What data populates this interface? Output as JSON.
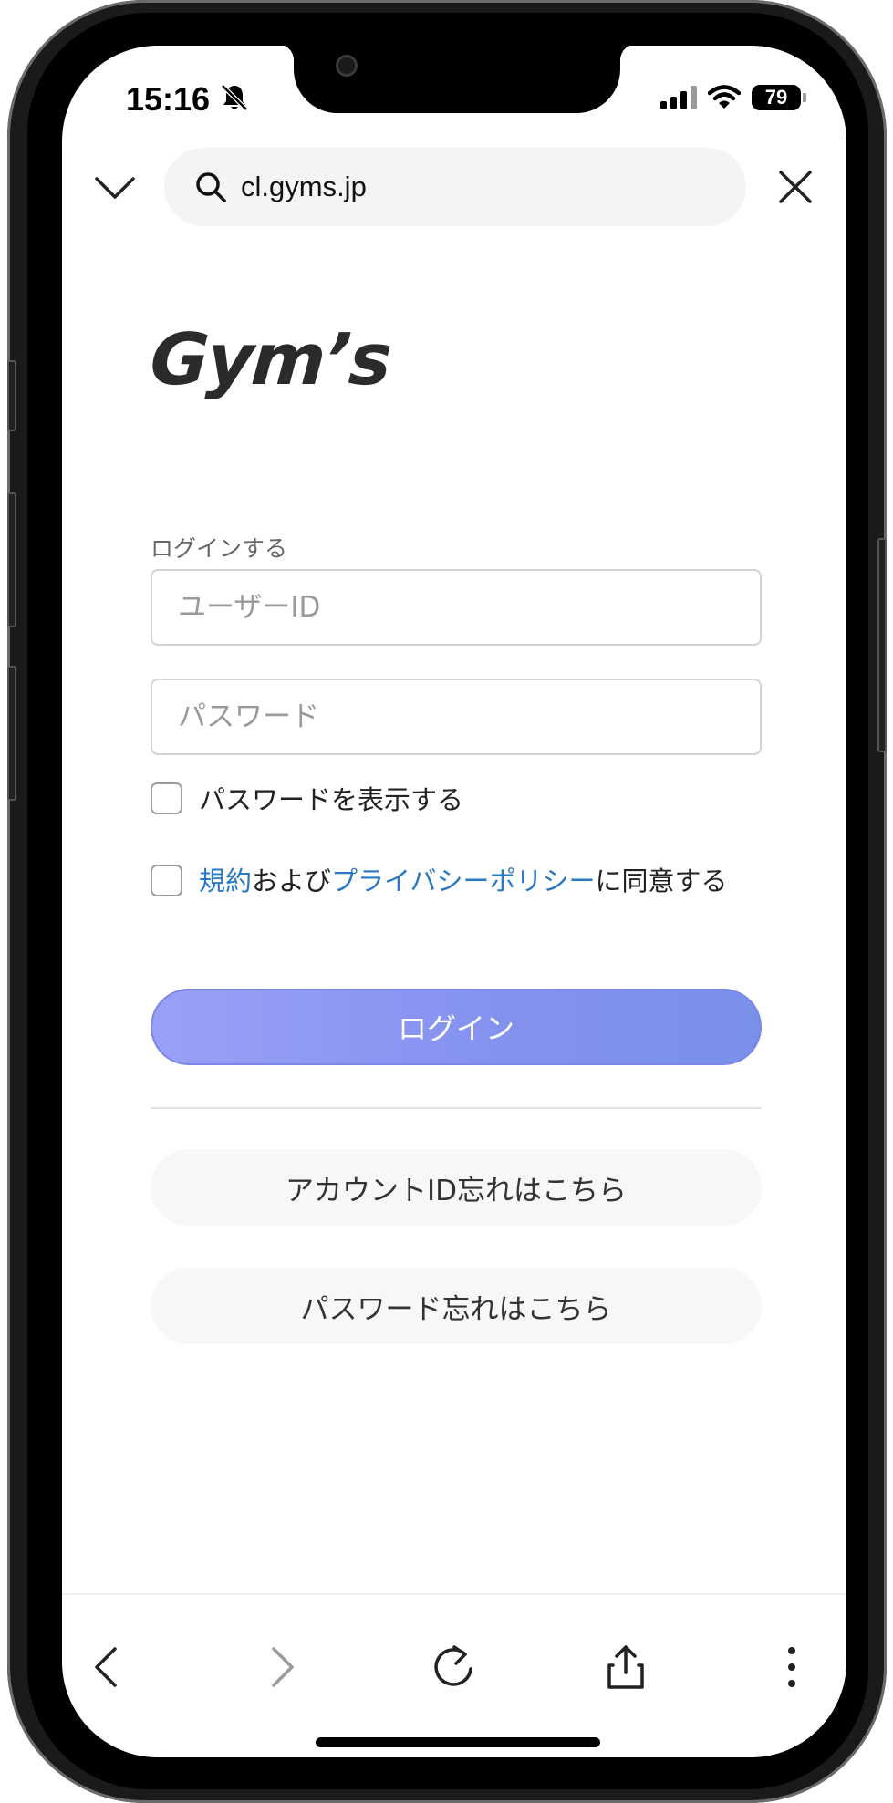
{
  "status_bar": {
    "time": "15:16",
    "battery": "79"
  },
  "browser": {
    "url": "cl.gyms.jp"
  },
  "page": {
    "logo": "Gym’s",
    "login_label": "ログインする",
    "user_id_placeholder": "ユーザーID",
    "password_placeholder": "パスワード",
    "show_password_label": "パスワードを表示する",
    "agree": {
      "terms_link": "規約",
      "and_text": "および",
      "privacy_link": "プライバシーポリシー",
      "suffix": "に同意する"
    },
    "login_button": "ログイン",
    "forgot_account_button": "アカウントID忘れはこちら",
    "forgot_password_button": "パスワード忘れはこちら"
  },
  "colors": {
    "link": "#2b79c2",
    "login_gradient_start": "#9aa0f7",
    "login_gradient_end": "#7990ea"
  }
}
